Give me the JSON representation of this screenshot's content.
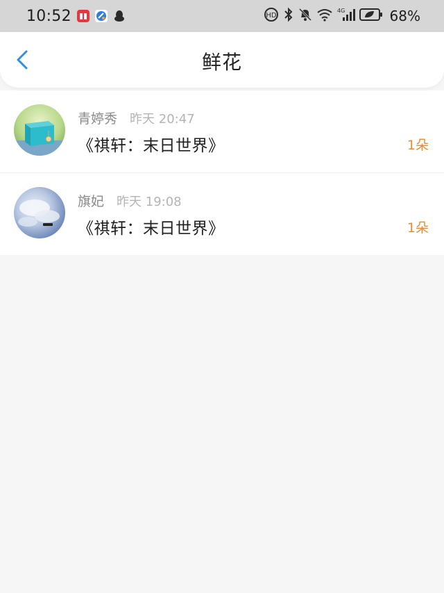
{
  "status_bar": {
    "time": "10:52",
    "battery": "68%",
    "icons": [
      "book-app-icon",
      "browser-app-icon",
      "qq-penguin-icon",
      "hd-call-icon",
      "bluetooth-icon",
      "mute-bell-icon",
      "wifi-icon",
      "signal-4g-icon",
      "battery-icon"
    ]
  },
  "nav": {
    "title": "鲜花",
    "back_icon": "chevron-left-icon",
    "accent": "#2f8fe0"
  },
  "records": [
    {
      "user": "青婷秀",
      "time": "昨天 20:47",
      "book": "《祺轩：末日世界》",
      "count": "1朵",
      "avatar": "teal-gift-box-photo"
    },
    {
      "user": "旗妃",
      "time": "昨天 19:08",
      "book": "《祺轩：末日世界》",
      "count": "1朵",
      "avatar": "cloudy-sky-photo"
    }
  ],
  "colors": {
    "count_orange": "#e78b36",
    "status_bar_bg": "#d6d6d6",
    "page_bg": "#f7f6f7"
  }
}
